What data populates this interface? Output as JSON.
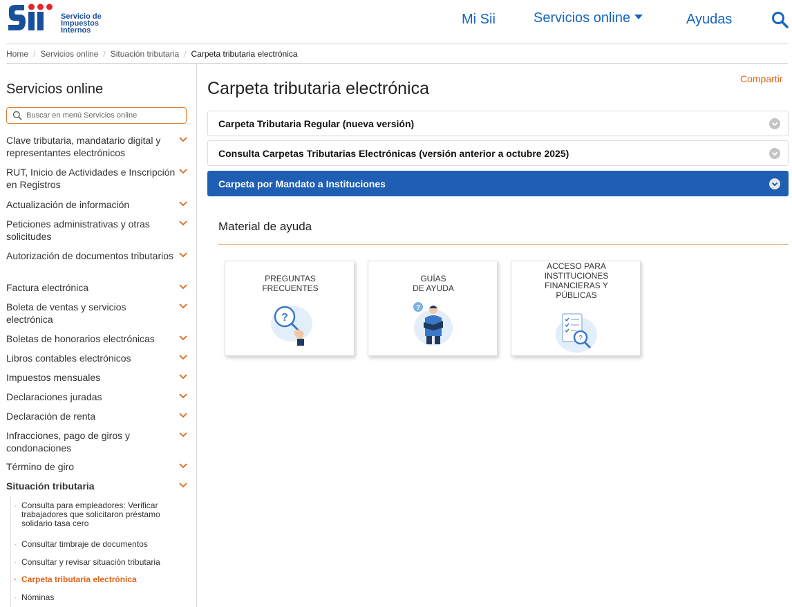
{
  "header": {
    "logo_lines": [
      "Servicio de",
      "Impuestos",
      "Internos"
    ],
    "nav": {
      "mi_sii": "Mi Sii",
      "servicios_online": "Servicios online",
      "ayudas": "Ayudas"
    }
  },
  "breadcrumb": [
    "Home",
    "Servicios online",
    "Situación tributaria",
    "Carpeta tributaria electrónica"
  ],
  "sidebar": {
    "title": "Servicios online",
    "search_placeholder": "Buscar en menú Servicios online",
    "items": [
      {
        "label": "Clave tributaria, mandatario digital y representantes electrónicos"
      },
      {
        "label": "RUT, Inicio de Actividades e Inscripción en Registros"
      },
      {
        "label": "Actualización de información"
      },
      {
        "label": "Peticiones administrativas y otras solicitudes"
      },
      {
        "label": "Autorización de documentos tributarios"
      },
      {
        "label": "Factura electrónica"
      },
      {
        "label": "Boleta de ventas y servicios electrónica"
      },
      {
        "label": "Boletas de honorarios electrónicas"
      },
      {
        "label": "Libros contables electrónicos"
      },
      {
        "label": "Impuestos mensuales"
      },
      {
        "label": "Declaraciones juradas"
      },
      {
        "label": "Declaración de renta"
      },
      {
        "label": "Infracciones, pago de giros y condonaciones"
      },
      {
        "label": "Término de giro"
      },
      {
        "label": "Situación tributaria"
      }
    ],
    "subitems": [
      {
        "label": "Consulta para empleadores: Verificar trabajadores que solicitaron préstamo solidario tasa cero"
      },
      {
        "label": "Consultar timbraje de documentos"
      },
      {
        "label": "Consultar y revisar situación tributaria"
      },
      {
        "label": "Carpeta tributaria electrónica"
      },
      {
        "label": "Nóminas"
      }
    ]
  },
  "main": {
    "share": "Compartir",
    "title": "Carpeta tributaria electrónica",
    "accordions": [
      {
        "label": "Carpeta Tributaria Regular (nueva versión)"
      },
      {
        "label": "Consulta Carpetas Tributarias Electrónicas (versión anterior a octubre 2025)"
      },
      {
        "label": "Carpeta por Mandato a Instituciones"
      }
    ],
    "help_title": "Material de ayuda",
    "cards": [
      {
        "lines": [
          "PREGUNTAS",
          "FRECUENTES"
        ],
        "icon": "question-magnifier-icon"
      },
      {
        "lines": [
          "GUÍAS",
          "DE AYUDA"
        ],
        "icon": "person-reading-icon"
      },
      {
        "lines": [
          "ACCESO PARA",
          "INSTITUCIONES",
          "FINANCIERAS Y",
          "PÚBLICAS"
        ],
        "icon": "checklist-magnifier-icon"
      }
    ]
  },
  "colors": {
    "brand_blue": "#1565c0",
    "accordion_active": "#1e5fb4",
    "accent_orange": "#e0641b",
    "logo_red": "#e5252a"
  }
}
